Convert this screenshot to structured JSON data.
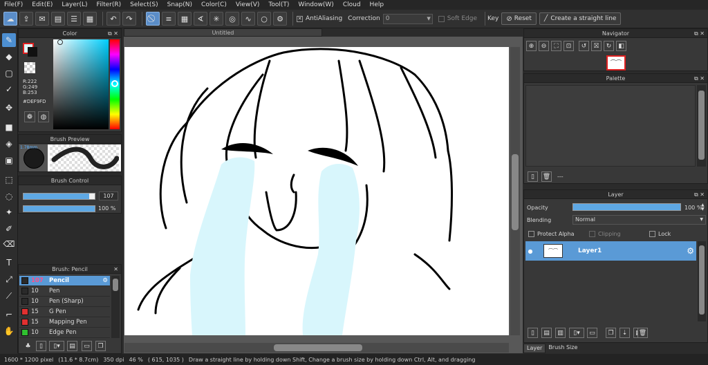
{
  "menu": [
    "File(F)",
    "Edit(E)",
    "Layer(L)",
    "Filter(R)",
    "Select(S)",
    "Snap(N)",
    "Color(C)",
    "View(V)",
    "Tool(T)",
    "Window(W)",
    "Cloud",
    "Help"
  ],
  "toolbar": {
    "antialiasing_label": "AntiAliasing",
    "correction_label": "Correction",
    "correction_value": "0",
    "soft_edge_label": "Soft Edge",
    "key_label": "Key",
    "reset_label": "Reset",
    "straight_line_label": "Create a straight line"
  },
  "color_panel": {
    "title": "Color",
    "r": "R:222",
    "g": "G:249",
    "b": "B:253",
    "hex": "#DEF9FD",
    "foreground": "#def9fd"
  },
  "brush_preview": {
    "title": "Brush Preview",
    "size_label": "1.78mm"
  },
  "brush_control": {
    "title": "Brush Control",
    "size": "107",
    "opacity": "100 %",
    "size_fraction": 0.92,
    "opacity_fraction": 1.0
  },
  "brush_list": {
    "title": "Brush: Pencil",
    "items": [
      {
        "size": "107",
        "name": "Pencil",
        "color": "#2a2a2a"
      },
      {
        "size": "10",
        "name": "Pen",
        "color": "#2a2a2a"
      },
      {
        "size": "10",
        "name": "Pen (Sharp)",
        "color": "#2a2a2a"
      },
      {
        "size": "15",
        "name": "G Pen",
        "color": "#e03030"
      },
      {
        "size": "15",
        "name": "Mapping Pen",
        "color": "#e03030"
      },
      {
        "size": "10",
        "name": "Edge Pen",
        "color": "#30c030"
      }
    ]
  },
  "canvas": {
    "tab_title": "Untitled"
  },
  "navigator": {
    "title": "Navigator"
  },
  "palette": {
    "title": "Palette",
    "status": "---"
  },
  "layer_panel": {
    "title": "Layer",
    "opacity_label": "Opacity",
    "opacity_value": "100 %",
    "opacity_fraction": 1.0,
    "blending_label": "Blending",
    "blending_value": "Normal",
    "protect_alpha": "Protect Alpha",
    "clipping": "Clipping",
    "lock": "Lock",
    "layer_name": "Layer1"
  },
  "bottom_tabs": [
    "Layer",
    "Brush Size"
  ],
  "status": {
    "size": "1600 * 1200 pixel",
    "physical": "(11.6 * 8.7cm)",
    "dpi": "350 dpi",
    "zoom": "46 %",
    "coords": "( 615, 1035 )",
    "hint": "Draw a straight line by holding down Shift, Change a brush size by holding down Ctrl, Alt, and dragging"
  }
}
